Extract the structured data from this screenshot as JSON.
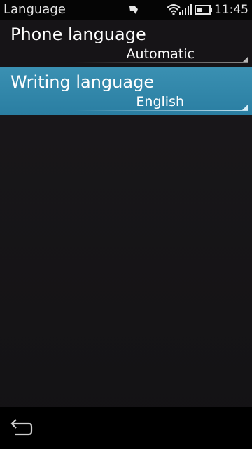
{
  "status_bar": {
    "title": "Language",
    "time": "11:45",
    "icons": [
      "notification-icon",
      "wifi-icon",
      "signal-strength-icon",
      "battery-icon"
    ]
  },
  "settings": {
    "items": [
      {
        "label": "Phone language",
        "value": "Automatic",
        "selected": false
      },
      {
        "label": "Writing language",
        "value": "English",
        "selected": true
      }
    ]
  },
  "toolbar": {
    "back_icon": "back-icon"
  },
  "colors": {
    "highlight": "#2f86a9",
    "background": "#161417",
    "status_bar": "#050505"
  }
}
